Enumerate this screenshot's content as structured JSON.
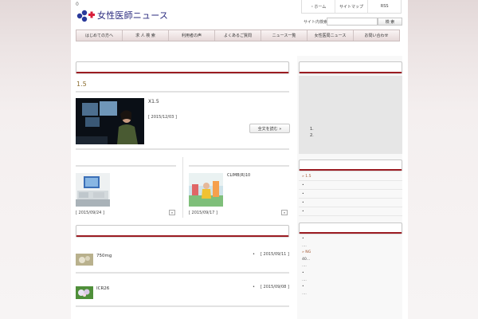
{
  "top_zero": "0",
  "logo": {
    "text": "女性医師ニュース"
  },
  "top_links": [
    "・ホーム",
    "サイトマップ",
    "RSS"
  ],
  "search": {
    "label": "サイト内検索",
    "button": "検 索",
    "value": ""
  },
  "nav": [
    "はじめての方へ",
    "求 人 検 索",
    "利用者の声",
    "よくあるご質問",
    "ニュース一覧",
    "女性医局ニュース",
    "お問い合わせ"
  ],
  "featured": {
    "title": "1.5",
    "item_text": "X1.5",
    "date": "[ 2015/12/03 ]",
    "read_more": "全文を読む »"
  },
  "cards": [
    {
      "caption": "",
      "date": "[ 2015/09/24 ]",
      "button": "»"
    },
    {
      "caption": "CLIMB(R)10",
      "date": "[ 2015/09/17 ]",
      "button": "»"
    }
  ],
  "news": [
    {
      "title": "750mg",
      "bullet": "•",
      "date": "[ 2015/09/11 ]"
    },
    {
      "title": "ICR26",
      "bullet": "•",
      "date": "[ 2015/09/08 ]"
    }
  ],
  "sidebar": {
    "ol_items": [
      "1.",
      "2."
    ],
    "list1": [
      "» 1.5",
      "•",
      "•",
      "•",
      "•"
    ],
    "list2": [
      "•",
      "....",
      "» NG",
      "40...",
      "....",
      "•",
      "....",
      "•",
      "...."
    ]
  }
}
